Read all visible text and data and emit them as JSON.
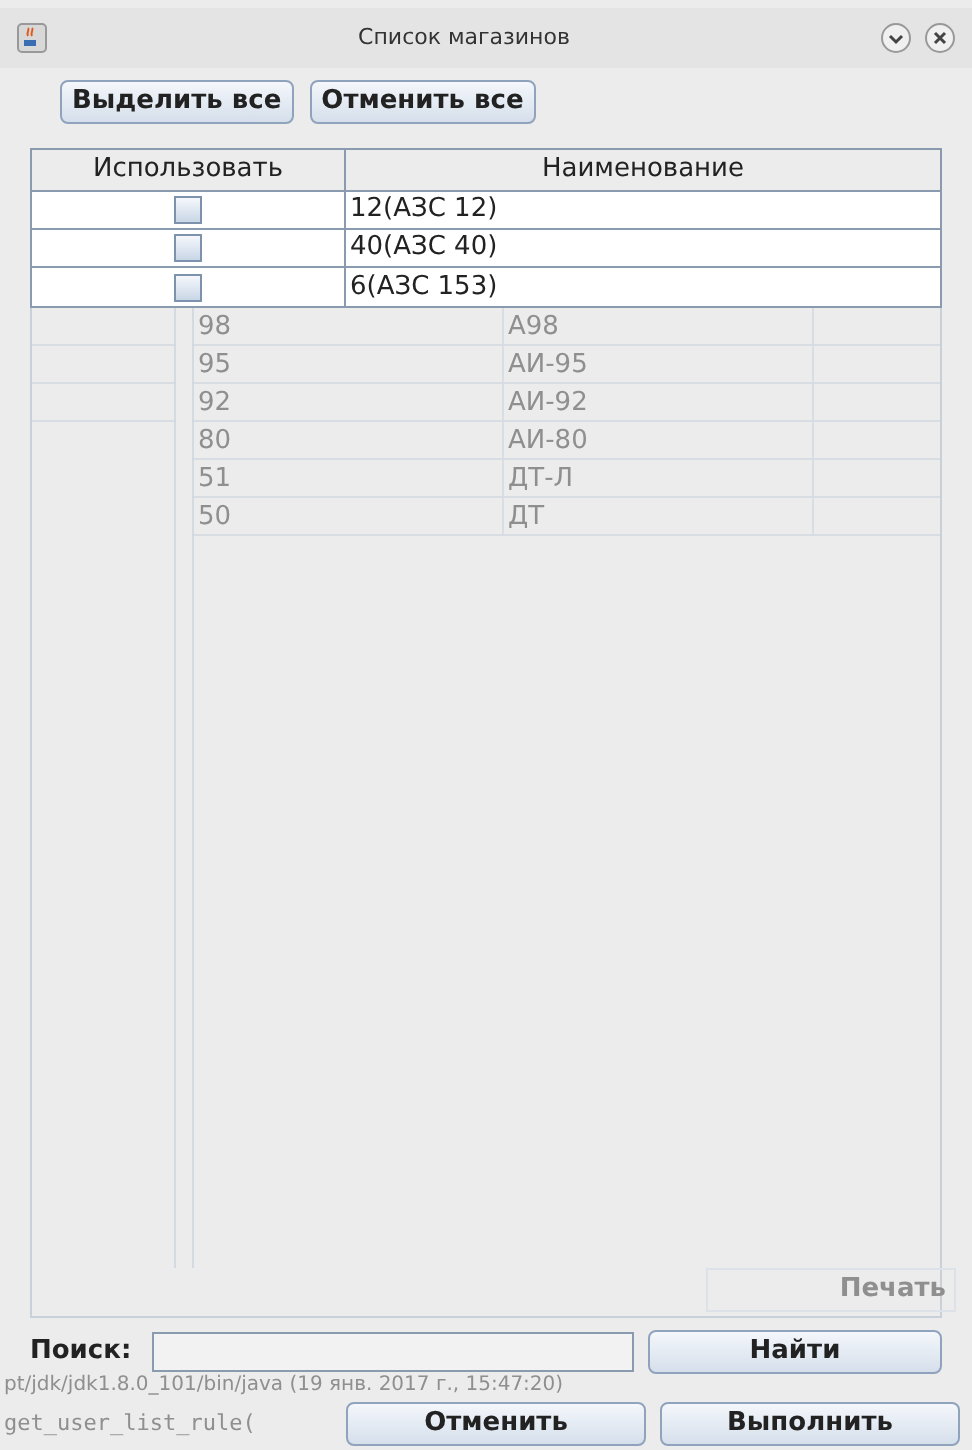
{
  "window": {
    "title": "Список магазинов"
  },
  "toolbar": [
    "Выделить все",
    "Отменить все"
  ],
  "stores": {
    "columns": [
      "Использовать",
      "Наименование"
    ],
    "rows": [
      {
        "name": "12(АЗС 12)",
        "checked": false
      },
      {
        "name": "40(АЗС 40)",
        "checked": false
      },
      {
        "name": "6(АЗС 153)",
        "checked": false
      }
    ]
  },
  "background": {
    "rows": [
      {
        "code": "98",
        "sort": "A98"
      },
      {
        "code": "95",
        "sort": "АИ-95"
      },
      {
        "code": "92",
        "sort": "АИ-92"
      },
      {
        "code": "80",
        "sort": "АИ-80"
      },
      {
        "code": "51",
        "sort": "ДТ-Л"
      },
      {
        "code": "50",
        "sort": "ДТ"
      }
    ],
    "print_button": "Печать",
    "status_line": "pt/jdk/jdk1.8.0_101/bin/java (19 янв. 2017 г., 15:47:20)",
    "code_line": "get_user_list_rule("
  },
  "search": {
    "label": "Поиск:",
    "button": "Найти"
  },
  "buttons": [
    "Отменить",
    "Выполнить"
  ]
}
